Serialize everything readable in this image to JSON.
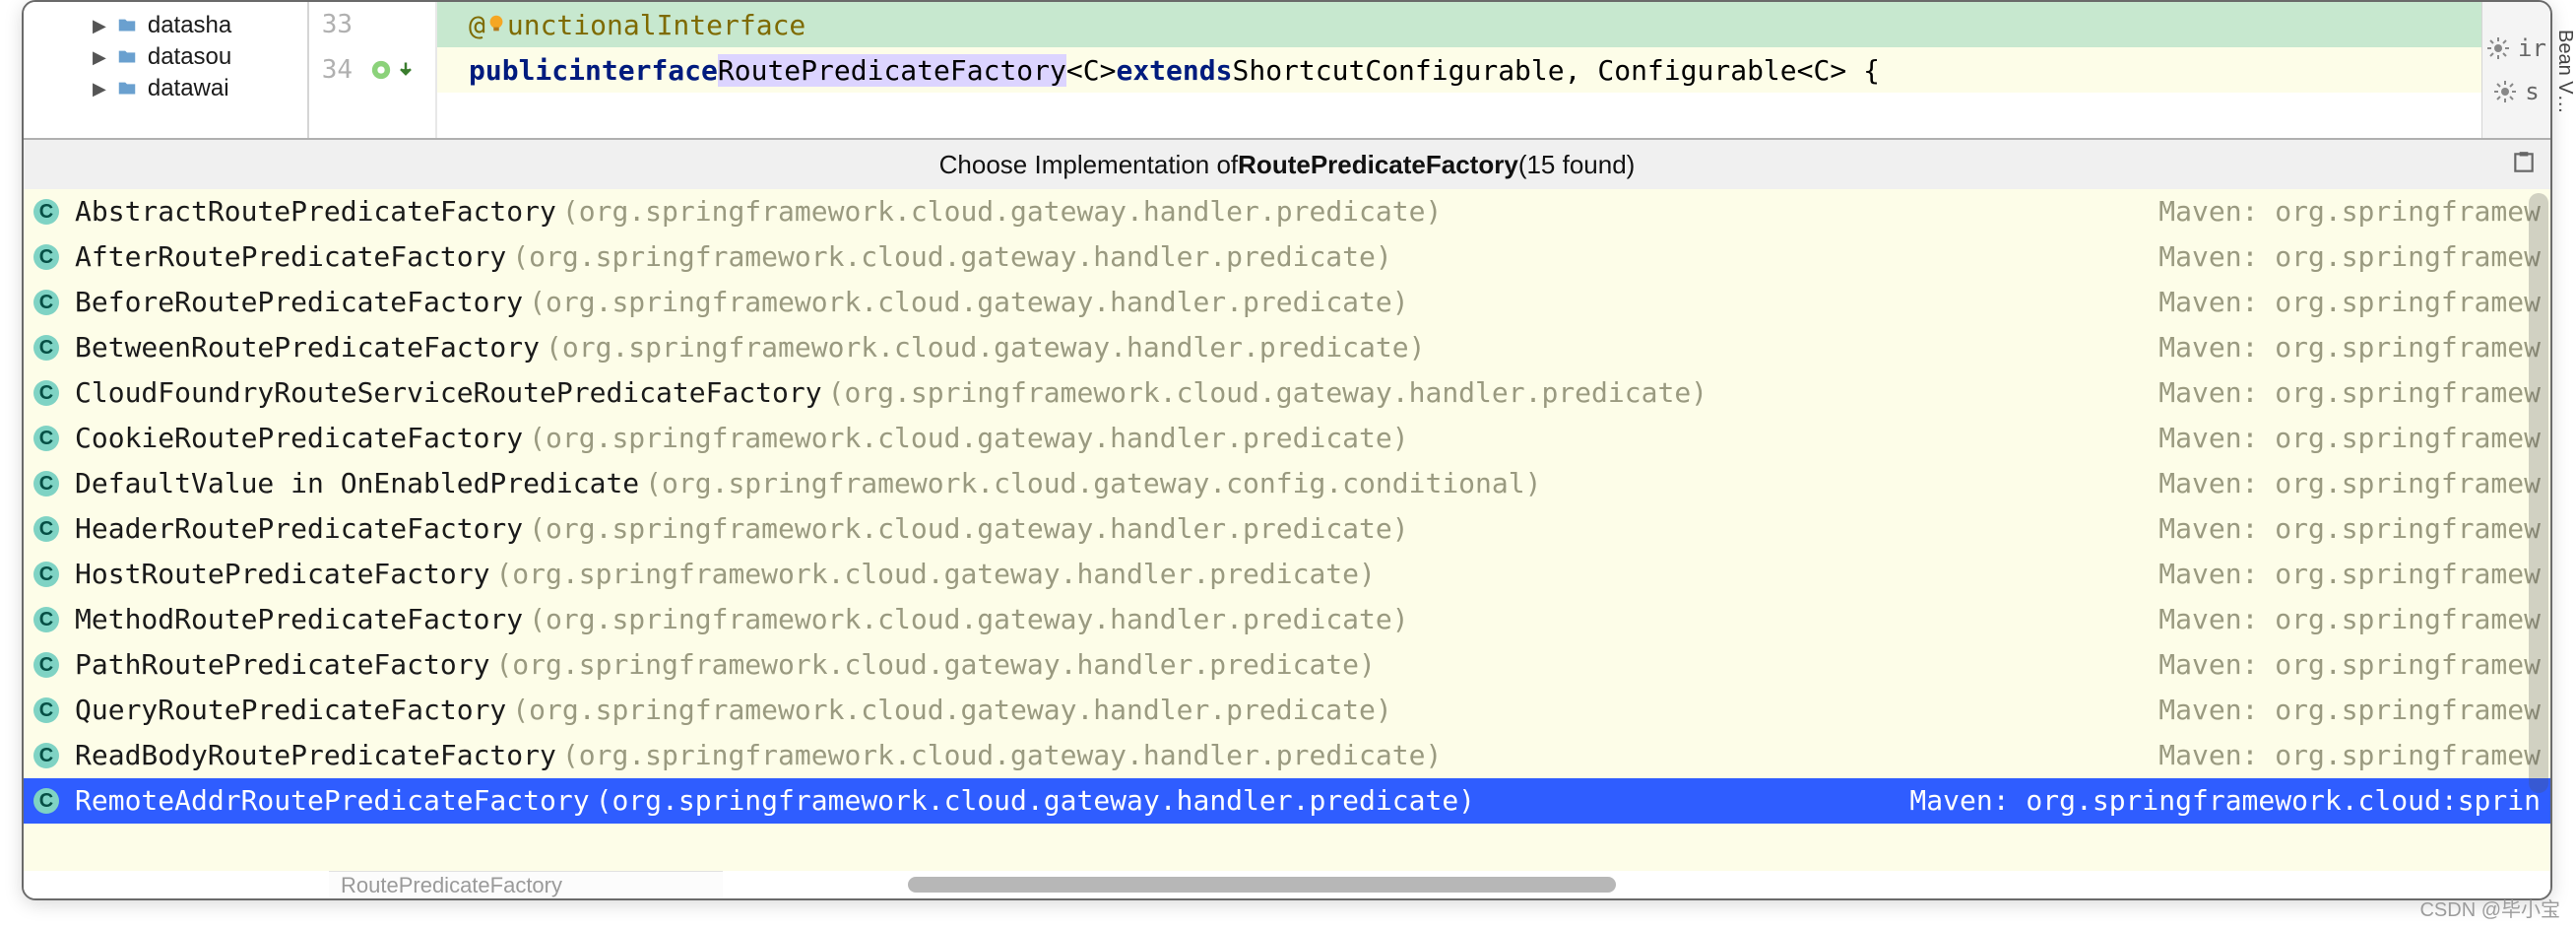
{
  "sidepanel_label": "Bean V…",
  "tree": {
    "items": [
      {
        "label": "datasha"
      },
      {
        "label": "datasou"
      },
      {
        "label": "datawai"
      }
    ]
  },
  "editor": {
    "lines": [
      {
        "num": "33",
        "annotation": "@",
        "annotation_text": "unctionalInterface"
      },
      {
        "num": "34"
      }
    ],
    "code_kw_public": "public",
    "code_kw_interface": "interface",
    "code_type": "RoutePredicateFactory",
    "code_generics": "<C>",
    "code_kw_extends": "extends",
    "code_rest": "ShortcutConfigurable, Configurable<C> {"
  },
  "right_gutter": {
    "row1": "ir",
    "row2": "s"
  },
  "popup": {
    "title_prefix": "Choose Implementation of ",
    "title_bold": "RoutePredicateFactory",
    "title_suffix": " (15 found)",
    "rows": [
      {
        "name": "AbstractRoutePredicateFactory",
        "pkg": "(org.springframework.cloud.gateway.handler.predicate)",
        "lib": "Maven: org.springframew",
        "selected": false
      },
      {
        "name": "AfterRoutePredicateFactory",
        "pkg": "(org.springframework.cloud.gateway.handler.predicate)",
        "lib": "Maven: org.springframew",
        "selected": false
      },
      {
        "name": "BeforeRoutePredicateFactory",
        "pkg": "(org.springframework.cloud.gateway.handler.predicate)",
        "lib": "Maven: org.springframew",
        "selected": false
      },
      {
        "name": "BetweenRoutePredicateFactory",
        "pkg": "(org.springframework.cloud.gateway.handler.predicate)",
        "lib": "Maven: org.springframew",
        "selected": false
      },
      {
        "name": "CloudFoundryRouteServiceRoutePredicateFactory",
        "pkg": "(org.springframework.cloud.gateway.handler.predicate)",
        "lib": "Maven: org.springframew",
        "selected": false
      },
      {
        "name": "CookieRoutePredicateFactory",
        "pkg": "(org.springframework.cloud.gateway.handler.predicate)",
        "lib": "Maven: org.springframew",
        "selected": false
      },
      {
        "name": "DefaultValue in OnEnabledPredicate",
        "pkg": "(org.springframework.cloud.gateway.config.conditional)",
        "lib": "Maven: org.springframew",
        "selected": false
      },
      {
        "name": "HeaderRoutePredicateFactory",
        "pkg": "(org.springframework.cloud.gateway.handler.predicate)",
        "lib": "Maven: org.springframew",
        "selected": false
      },
      {
        "name": "HostRoutePredicateFactory",
        "pkg": "(org.springframework.cloud.gateway.handler.predicate)",
        "lib": "Maven: org.springframew",
        "selected": false
      },
      {
        "name": "MethodRoutePredicateFactory",
        "pkg": "(org.springframework.cloud.gateway.handler.predicate)",
        "lib": "Maven: org.springframew",
        "selected": false
      },
      {
        "name": "PathRoutePredicateFactory",
        "pkg": "(org.springframework.cloud.gateway.handler.predicate)",
        "lib": "Maven: org.springframew",
        "selected": false
      },
      {
        "name": "QueryRoutePredicateFactory",
        "pkg": "(org.springframework.cloud.gateway.handler.predicate)",
        "lib": "Maven: org.springframew",
        "selected": false
      },
      {
        "name": "ReadBodyRoutePredicateFactory",
        "pkg": "(org.springframework.cloud.gateway.handler.predicate)",
        "lib": "Maven: org.springframew",
        "selected": false
      },
      {
        "name": "RemoteAddrRoutePredicateFactory",
        "pkg": "(org.springframework.cloud.gateway.handler.predicate)",
        "lib": "Maven: org.springframework.cloud:sprin",
        "selected": true
      }
    ]
  },
  "breadcrumb": "RoutePredicateFactory",
  "watermark": "CSDN @毕小宝"
}
